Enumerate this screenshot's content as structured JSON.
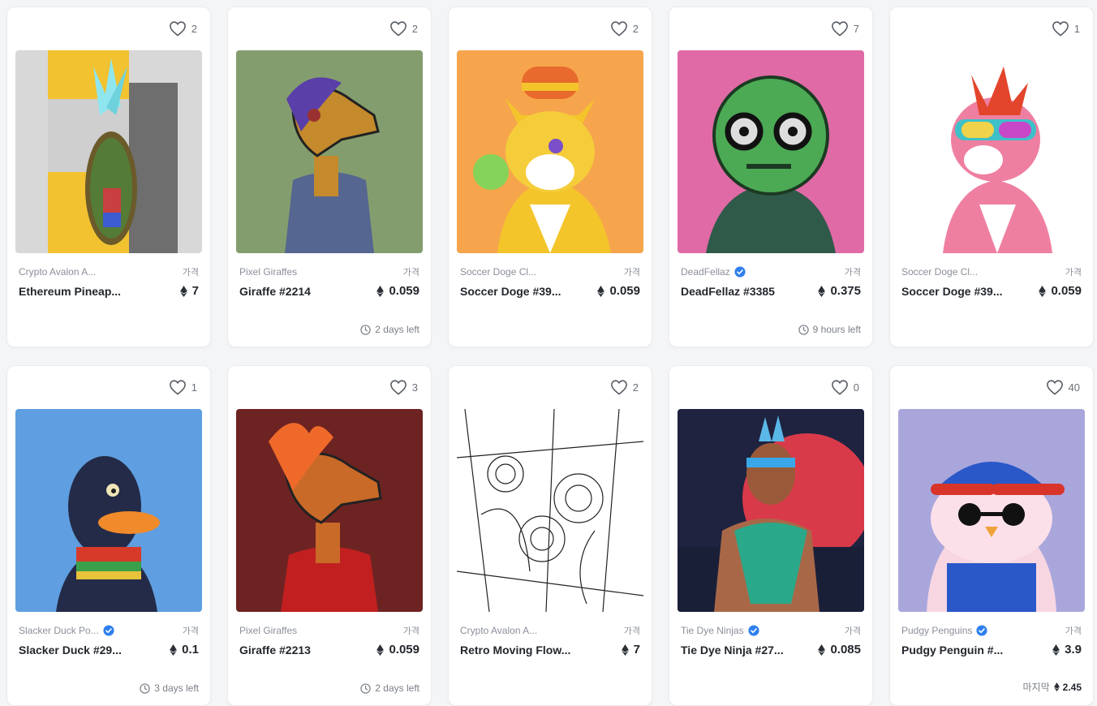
{
  "price_label": "가격",
  "cards": [
    {
      "likes": "2",
      "collection": "Crypto Avalon A...",
      "verified": false,
      "name": "Ethereum Pineap...",
      "price": "7",
      "footer": "",
      "image": "pineapple-artwork",
      "bg": "#f2c230"
    },
    {
      "likes": "2",
      "collection": "Pixel Giraffes",
      "verified": false,
      "name": "Giraffe #2214",
      "price": "0.059",
      "footer": "2 days left",
      "image": "giraffe-purple-hair",
      "bg": "#849d6e"
    },
    {
      "likes": "2",
      "collection": "Soccer Doge Cl...",
      "verified": false,
      "name": "Soccer Doge #39...",
      "price": "0.059",
      "footer": "",
      "image": "doge-bubblegum",
      "bg": "#f6a54c"
    },
    {
      "likes": "7",
      "collection": "DeadFellaz",
      "verified": true,
      "name": "DeadFellaz #3385",
      "price": "0.375",
      "footer": "9 hours left",
      "image": "green-zombie",
      "bg": "#e06aa6"
    },
    {
      "likes": "1",
      "collection": "Soccer Doge Cl...",
      "verified": false,
      "name": "Soccer Doge #39...",
      "price": "0.059",
      "footer": "",
      "image": "pink-doge-goggles",
      "bg": "#ffffff"
    },
    {
      "likes": "1",
      "collection": "Slacker Duck Po...",
      "verified": true,
      "name": "Slacker Duck #29...",
      "price": "0.1",
      "footer": "3 days left",
      "image": "slacker-duck",
      "bg": "#5f9ee0"
    },
    {
      "likes": "3",
      "collection": "Pixel Giraffes",
      "verified": false,
      "name": "Giraffe #2213",
      "price": "0.059",
      "footer": "2 days left",
      "image": "giraffe-fire-hair",
      "bg": "#6e2323"
    },
    {
      "likes": "2",
      "collection": "Crypto Avalon A...",
      "verified": false,
      "name": "Retro Moving Flow...",
      "price": "7",
      "footer": "",
      "image": "flowers-sketch",
      "bg": "#ffffff"
    },
    {
      "likes": "0",
      "collection": "Tie Dye Ninjas",
      "verified": true,
      "name": "Tie Dye Ninja #27...",
      "price": "0.085",
      "footer": "",
      "image": "tie-dye-ninja",
      "bg": "#1f2340"
    },
    {
      "likes": "40",
      "collection": "Pudgy Penguins",
      "verified": true,
      "name": "Pudgy Penguin #...",
      "price": "3.9",
      "footer": "",
      "last_label": "마지막",
      "last_price": "2.45",
      "image": "pudgy-penguin",
      "bg": "#a9a6dc"
    }
  ],
  "colors": {
    "verified": "#2f80ed",
    "muted": "#8a8f98",
    "text": "#23272d"
  }
}
